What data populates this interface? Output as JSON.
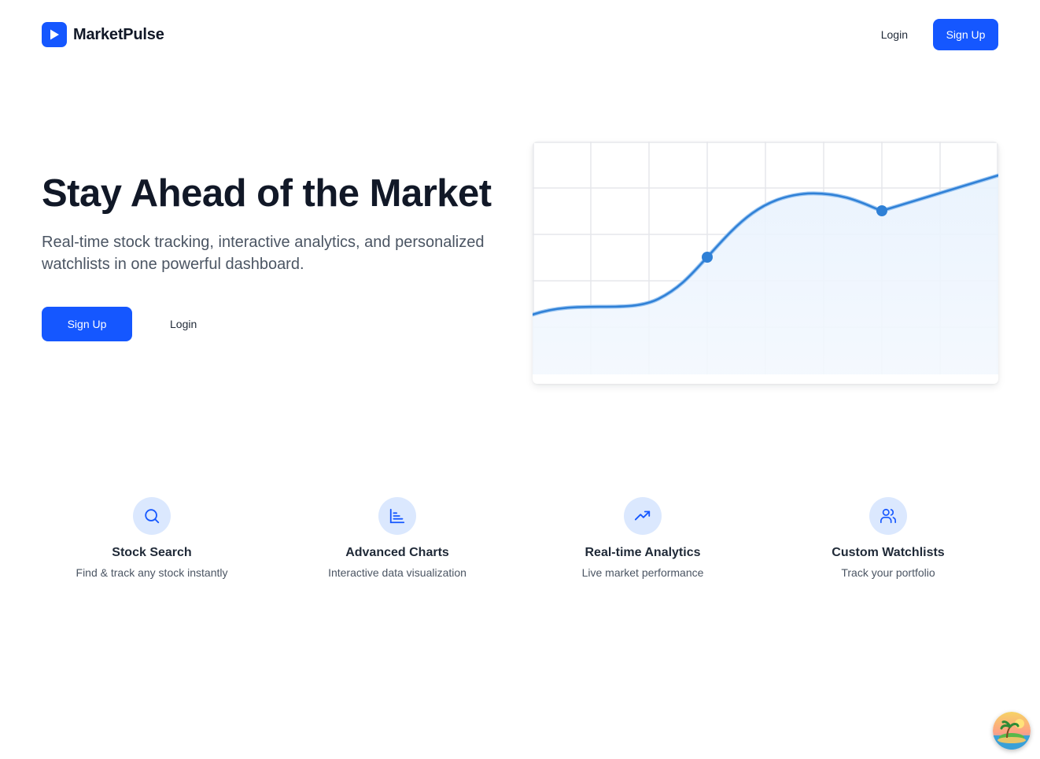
{
  "header": {
    "brand_name": "MarketPulse",
    "login_label": "Login",
    "signup_label": "Sign Up"
  },
  "hero": {
    "title": "Stay Ahead of the Market",
    "subtitle": "Real-time stock tracking, interactive analytics, and personalized watchlists in one powerful dashboard.",
    "signup_label": "Sign Up",
    "login_label": "Login"
  },
  "features": [
    {
      "icon": "search-icon",
      "title": "Stock Search",
      "description": "Find & track any stock instantly"
    },
    {
      "icon": "bar-chart-icon",
      "title": "Advanced Charts",
      "description": "Interactive data visualization"
    },
    {
      "icon": "trending-up-icon",
      "title": "Real-time Analytics",
      "description": "Live market performance"
    },
    {
      "icon": "users-icon",
      "title": "Custom Watchlists",
      "description": "Track your portfolio"
    }
  ],
  "colors": {
    "primary": "#1557ff",
    "chart_line": "#2f80d6",
    "icon_bg": "#dbe8fe",
    "heading": "#111827",
    "body": "#4b5563"
  }
}
